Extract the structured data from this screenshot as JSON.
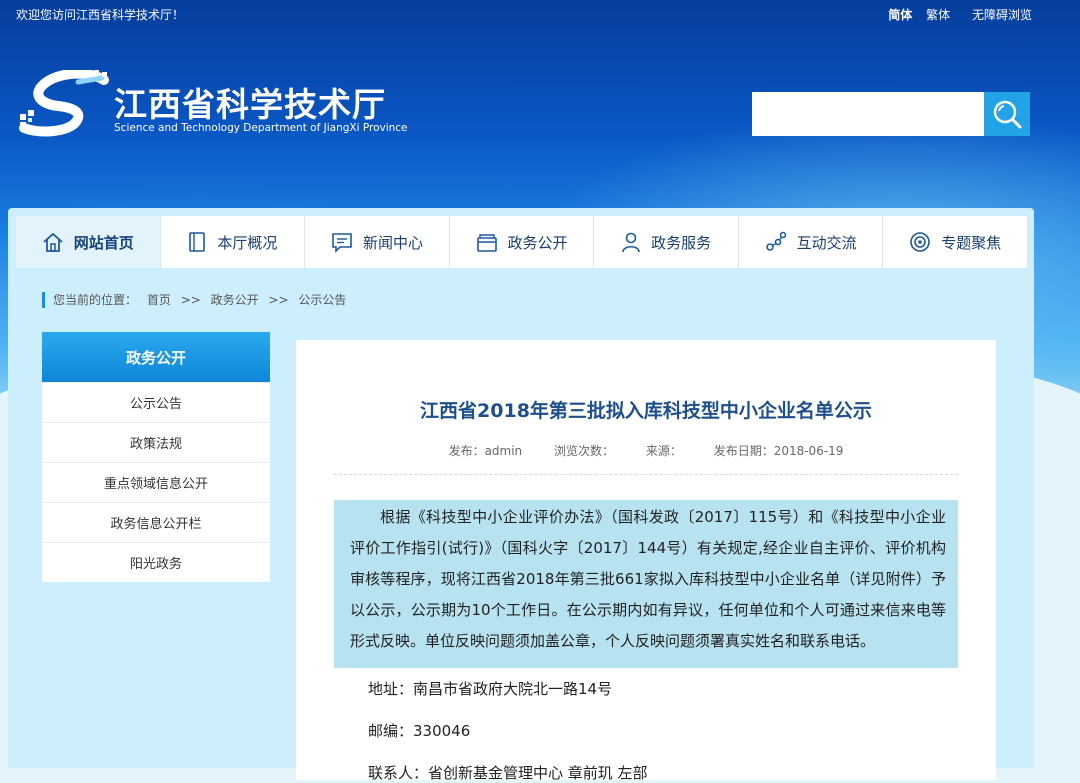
{
  "topbar": {
    "welcome": "欢迎您访问江西省科学技术厅！",
    "links": [
      "简体",
      "繁体",
      "无障碍浏览"
    ]
  },
  "logo": {
    "name_cn": "江西省科学技术厅",
    "name_en": "Science and Technology Department of JiangXi Province"
  },
  "search": {
    "placeholder": ""
  },
  "nav": [
    {
      "label": "网站首页",
      "icon": "home-icon"
    },
    {
      "label": "本厅概况",
      "icon": "book-icon"
    },
    {
      "label": "新闻中心",
      "icon": "chat-icon"
    },
    {
      "label": "政务公开",
      "icon": "folder-icon"
    },
    {
      "label": "政务服务",
      "icon": "user-icon"
    },
    {
      "label": "互动交流",
      "icon": "share-icon"
    },
    {
      "label": "专题聚焦",
      "icon": "target-icon"
    }
  ],
  "breadcrumb": {
    "prefix": "您当前的位置：",
    "items": [
      "首页",
      ">>",
      "政务公开",
      ">>",
      "公示公告"
    ]
  },
  "sidebar": {
    "title": "政务公开",
    "items": [
      "公示公告",
      "政策法规",
      "重点领域信息公开",
      "政务信息公开栏",
      "阳光政务"
    ]
  },
  "article": {
    "title": "江西省2018年第三批拟入库科技型中小企业名单公示",
    "meta": {
      "publisher": "发布：admin",
      "views": "浏览次数：",
      "source": "来源：",
      "date": "发布日期：2018-06-19"
    },
    "body": "根据《科技型中小企业评价办法》（国科发政〔2017〕115号）和《科技型中小企业评价工作指引(试行)》（国科火字〔2017〕144号）有关规定,经企业自主评价、评价机构审核等程序，现将江西省2018年第三批661家拟入库科技型中小企业名单（详见附件）予以公示，公示期为10个工作日。在公示期内如有异议，任何单位和个人可通过来信来电等形式反映。单位反映问题须加盖公章，个人反映问题须署真实姓名和联系电话。",
    "address": "地址：南昌市省政府大院北一路14号",
    "postcode": "邮编：330046",
    "contact": "联系人：省创新基金管理中心 章前玑 左部"
  },
  "colors": {
    "accent": "#1c8ee0",
    "title": "#1d4f8c",
    "selection": "#b7e3f1"
  }
}
